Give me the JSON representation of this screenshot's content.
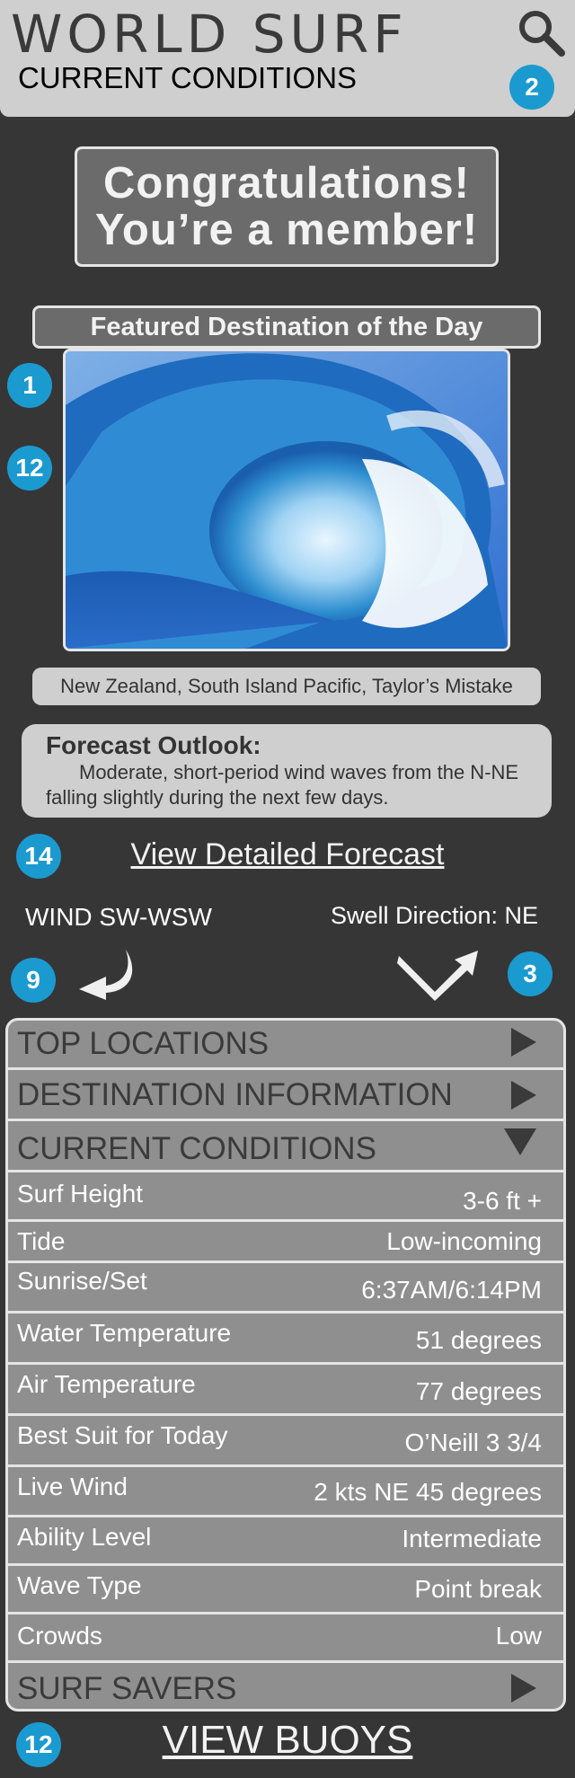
{
  "header": {
    "brand": "WORLD SURF",
    "subtitle": "CURRENT CONDITIONS"
  },
  "badges": {
    "search_badge": "2",
    "photo_badge_top": "1",
    "photo_badge_bottom": "12",
    "forecast_badge": "14",
    "wind_badge": "9",
    "swell_badge": "3",
    "buoys_badge": "12"
  },
  "congrats": {
    "line1": "Congratulations!",
    "line2": "You’re a member!"
  },
  "featured": {
    "title": "Featured Destination of the Day",
    "location": "New Zealand, South Island Pacific, Taylor’s Mistake"
  },
  "outlook": {
    "title": "Forecast Outlook:",
    "text": "Moderate, short-period wind waves from the N-NE falling slightly during the next few days."
  },
  "links": {
    "forecast": "View Detailed Forecast",
    "buoys": "VIEW BUOYS"
  },
  "wind": {
    "label": "WIND SW-WSW",
    "swell": "Swell Direction: NE"
  },
  "panel": {
    "top_locations": "TOP LOCATIONS",
    "destination_info": "DESTINATION INFORMATION",
    "current_conditions": "CURRENT CONDITIONS",
    "surf_savers": "SURF SAVERS",
    "rows": [
      {
        "label": "Surf Height",
        "value": "3-6 ft +"
      },
      {
        "label": "Tide",
        "value": "Low-incoming"
      },
      {
        "label": "Sunrise/Set",
        "value": "6:37AM/6:14PM"
      },
      {
        "label": "Water Temperature",
        "value": "51 degrees"
      },
      {
        "label": "Air Temperature",
        "value": "77 degrees"
      },
      {
        "label": "Best Suit for Today",
        "value": "O’Neill 3 3/4"
      },
      {
        "label": "Live Wind",
        "value": "2 kts NE 45 degrees"
      },
      {
        "label": "Ability Level",
        "value": "Intermediate"
      },
      {
        "label": "Wave Type",
        "value": "Point break"
      },
      {
        "label": "Crowds",
        "value": "Low"
      }
    ]
  },
  "colors": {
    "background": "#363636",
    "badge": "#1b9ad0",
    "panel": "#8f8f8f",
    "light": "#cfcfcf"
  }
}
